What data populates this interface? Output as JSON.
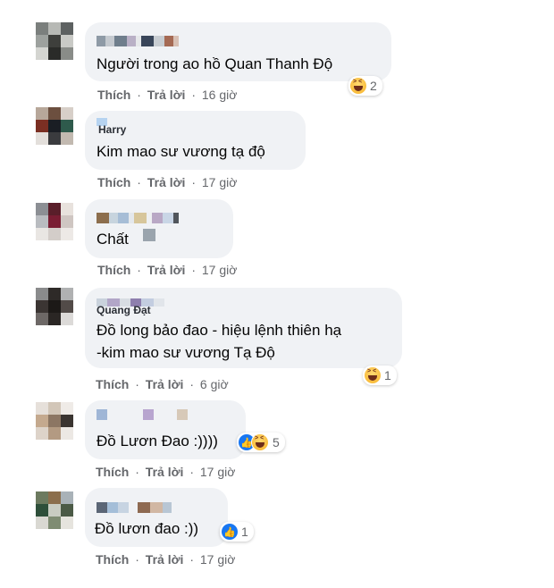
{
  "labels": {
    "like": "Thích",
    "reply": "Trả lời",
    "separator": "·"
  },
  "colors": {
    "bubble": "#f0f2f5",
    "meta": "#65676b",
    "link": "#1877f2"
  },
  "comments": [
    {
      "name": "",
      "text": "Người trong ao hồ Quan Thanh Độ",
      "time": "16 giờ",
      "reactions": [
        "haha"
      ],
      "count": "2"
    },
    {
      "name": "Harry",
      "text": "Kim mao sư vương tạ độ",
      "time": "17 giờ",
      "reactions": [],
      "count": ""
    },
    {
      "name": "",
      "text": "Chất",
      "time": "17 giờ",
      "reactions": [],
      "count": ""
    },
    {
      "name": "Quang Đạt",
      "text": "Đồ long bảo đao - hiệu lệnh thiên hạ",
      "text2": "-kim mao sư vương Tạ Độ",
      "time": "6 giờ",
      "reactions": [
        "haha"
      ],
      "count": "1"
    },
    {
      "name": "",
      "text": "Đồ Lươn Đao :))))",
      "time": "17 giờ",
      "reactions": [
        "like",
        "haha"
      ],
      "count": "5"
    },
    {
      "name": "",
      "text": "Đồ lươn đao :))",
      "time": "17 giờ",
      "reactions": [
        "like"
      ],
      "count": "1"
    }
  ]
}
